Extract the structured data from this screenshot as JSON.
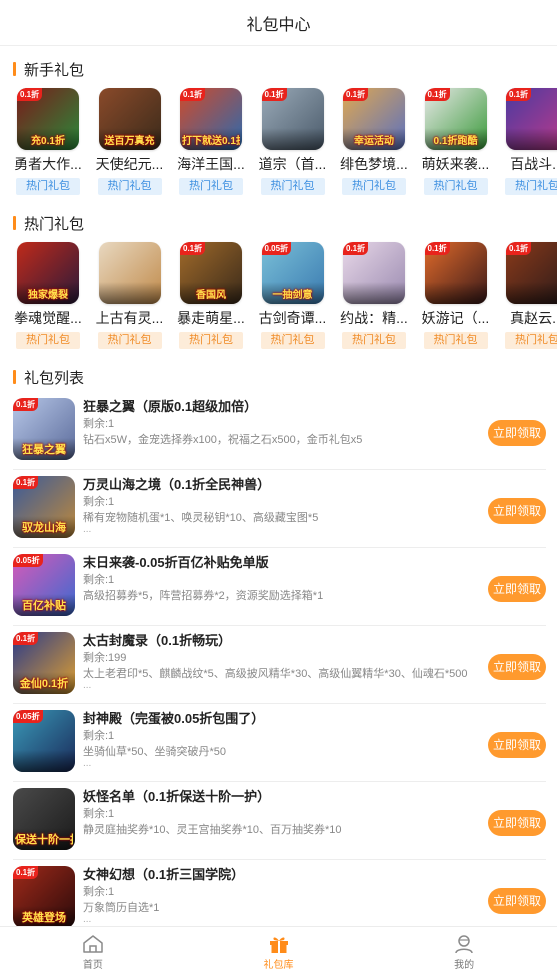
{
  "header": {
    "title": "礼包中心"
  },
  "sections": {
    "newbie": "新手礼包",
    "hot": "热门礼包",
    "list": "礼包列表"
  },
  "newbie_games": [
    {
      "name": "勇者大作...",
      "tag": "热门礼包",
      "badge": "0.1折",
      "caption": "充0.1折",
      "c1": "#7a1a1a",
      "c2": "#2a8a3a"
    },
    {
      "name": "天使纪元...",
      "tag": "热门礼包",
      "badge": "",
      "caption": "送百万真充",
      "c1": "#8a4a2a",
      "c2": "#3a2a1a"
    },
    {
      "name": "海洋王国...",
      "tag": "热门礼包",
      "badge": "0.1折",
      "caption": "打下就送0.1折",
      "c1": "#d04a2a",
      "c2": "#2a6ab0"
    },
    {
      "name": "道宗（首...",
      "tag": "热门礼包",
      "badge": "0.1折",
      "caption": "",
      "c1": "#9aaab8",
      "c2": "#4a5a6a"
    },
    {
      "name": "绯色梦境...",
      "tag": "热门礼包",
      "badge": "0.1折",
      "caption": "幸运活动",
      "c1": "#e0a850",
      "c2": "#5a70c0"
    },
    {
      "name": "萌妖来袭...",
      "tag": "热门礼包",
      "badge": "0.1折",
      "caption": "0.1折跑酷",
      "c1": "#e8e8e8",
      "c2": "#3a9a3a"
    },
    {
      "name": "百战斗...",
      "tag": "热门礼包",
      "badge": "0.1折",
      "caption": "",
      "c1": "#4a3aa0",
      "c2": "#c03a8a"
    }
  ],
  "hot_games": [
    {
      "name": "拳魂觉醒...",
      "tag": "热门礼包",
      "badge": "",
      "caption": "独家爆裂",
      "c1": "#c02a1a",
      "c2": "#2a1a3a"
    },
    {
      "name": "上古有灵...",
      "tag": "热门礼包",
      "badge": "",
      "caption": "",
      "c1": "#e8d8c0",
      "c2": "#c08a4a"
    },
    {
      "name": "暴走萌星...",
      "tag": "热门礼包",
      "badge": "0.1折",
      "caption": "香国风",
      "c1": "#a06a2a",
      "c2": "#3a2a1a"
    },
    {
      "name": "古剑奇谭...",
      "tag": "热门礼包",
      "badge": "0.05折",
      "caption": "一抽剑意",
      "c1": "#7ac0d8",
      "c2": "#3a7ab0"
    },
    {
      "name": "约战：精...",
      "tag": "热门礼包",
      "badge": "0.1折",
      "caption": "",
      "c1": "#e8d8e8",
      "c2": "#9a8ab0"
    },
    {
      "name": "妖游记（...",
      "tag": "热门礼包",
      "badge": "0.1折",
      "caption": "",
      "c1": "#e06a2a",
      "c2": "#3a1a1a"
    },
    {
      "name": "真赵云...",
      "tag": "热门礼包",
      "badge": "0.1折",
      "caption": "",
      "c1": "#8a3a1a",
      "c2": "#2a1a1a"
    }
  ],
  "gifts": [
    {
      "title": "狂暴之翼（原版0.1超级加倍）",
      "remain": "剩余:1",
      "content": "钻石x5W，金宠选择券x100，祝福之石x500，金币礼包x5",
      "more": "",
      "badge": "0.1折",
      "caption": "狂暴之翼",
      "c1": "#b8c8e8",
      "c2": "#5a6a9a"
    },
    {
      "title": "万灵山海之境（0.1折全民神兽）",
      "remain": "剩余:1",
      "content": "稀有宠物随机蛋*1、唤灵秘钥*10、高级藏宝图*5",
      "more": "...",
      "badge": "0.1折",
      "caption": "驭龙山海",
      "c1": "#3a5a9a",
      "c2": "#c08a3a"
    },
    {
      "title": "末日来袭-0.05折百亿补贴免单版",
      "remain": "剩余:1",
      "content": "高级招募券*5，阵营招募券*2，资源奖励选择箱*1",
      "more": "",
      "badge": "0.05折",
      "caption": "百亿补贴",
      "c1": "#d85ab8",
      "c2": "#3a6ad0"
    },
    {
      "title": "太古封魔录（0.1折畅玩）",
      "remain": "剩余:199",
      "content": "太上老君印*5、麒麟战纹*5、高级披风精华*30、高级仙翼精华*30、仙魂石*500",
      "more": "...",
      "badge": "0.1折",
      "caption": "金仙0.1折",
      "c1": "#2a3a8a",
      "c2": "#e0a030"
    },
    {
      "title": "封神殿（完蛋被0.05折包围了）",
      "remain": "剩余:1",
      "content": "坐骑仙草*50、坐骑突破丹*50",
      "more": "...",
      "badge": "0.05折",
      "caption": "",
      "c1": "#3a9ab8",
      "c2": "#1a2a5a"
    },
    {
      "title": "妖怪名单（0.1折保送十阶一护）",
      "remain": "剩余:1",
      "content": "静灵庭抽奖券*10、灵王宫抽奖券*10、百万抽奖券*10",
      "more": "",
      "badge": "",
      "caption": "保送十阶一护",
      "c1": "#4a4a4a",
      "c2": "#1a1a1a"
    },
    {
      "title": "女神幻想（0.1折三国学院）",
      "remain": "剩余:1",
      "content": "万象筒历自选*1",
      "more": "...",
      "badge": "0.1折",
      "caption": "英雄登场",
      "c1": "#a02a1a",
      "c2": "#2a0a0a"
    }
  ],
  "claim_label": "立即领取",
  "tabs": [
    {
      "label": "首页",
      "icon": "home-icon"
    },
    {
      "label": "礼包库",
      "icon": "gift-icon"
    },
    {
      "label": "我的",
      "icon": "profile-icon"
    }
  ],
  "colors": {
    "accent": "#ff8c1a",
    "button": "#ff9a2e",
    "tag_blue_bg": "#e3f0fc",
    "tag_orange_bg": "#fdecd9"
  }
}
